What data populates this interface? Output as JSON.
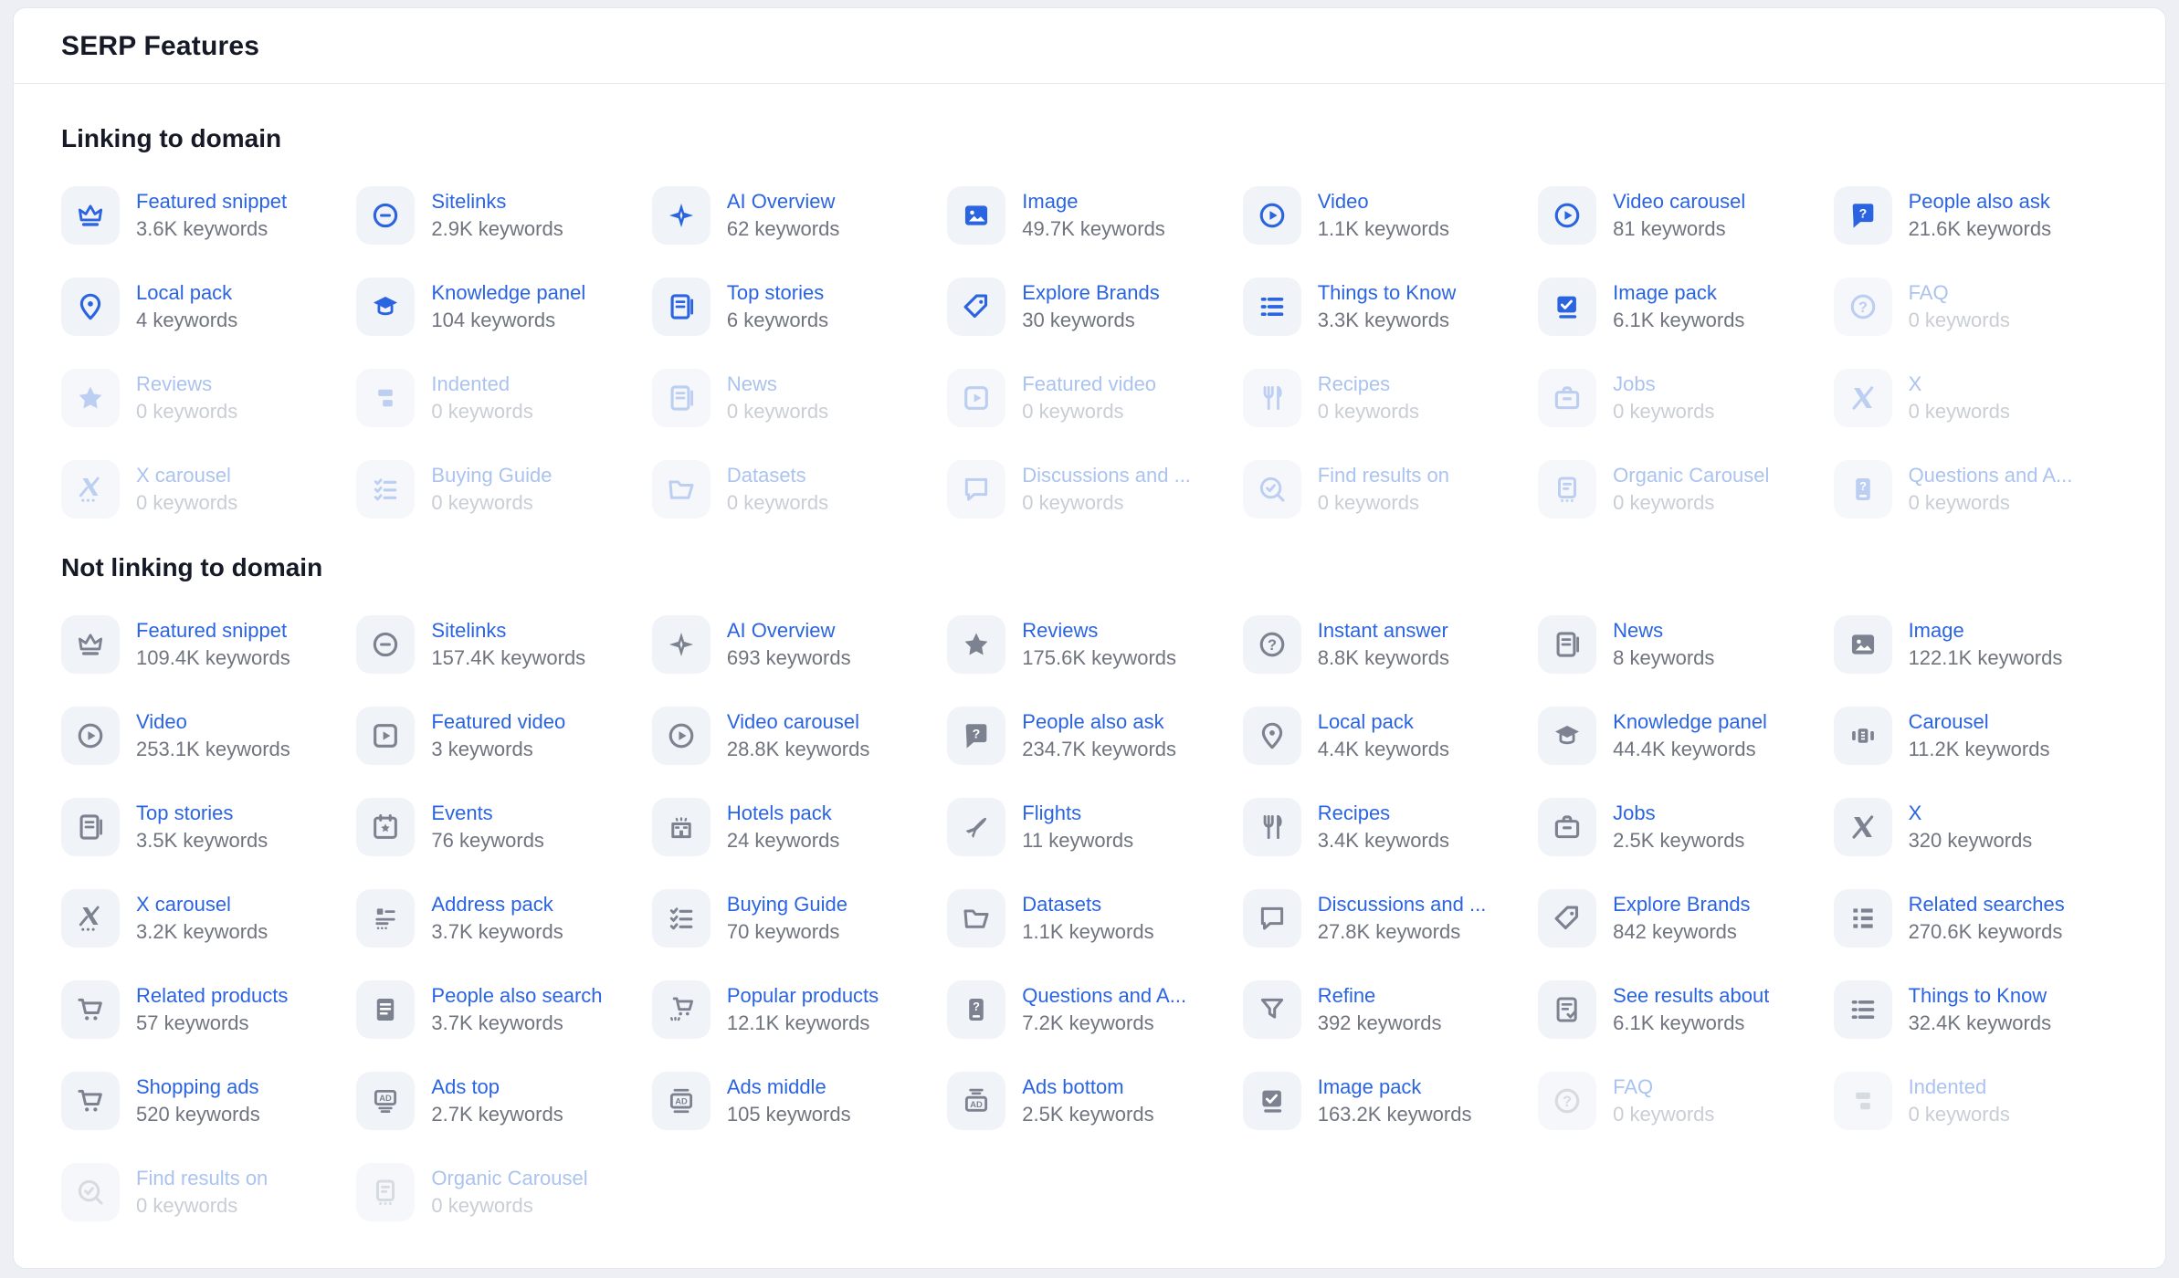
{
  "page_title": "SERP Features",
  "colors": {
    "accent_blue": "#2b64e0",
    "icon_gray": "#7c828f",
    "tile_background": "#f0f3f8",
    "count_gray": "#70747e",
    "disabled_blue": "#abc3ee",
    "card_background": "#ffffff",
    "page_background": "#edeff4"
  },
  "sections": [
    {
      "title": "Linking to domain",
      "icon_tone": "blue",
      "items": [
        {
          "label": "Featured snippet",
          "count": "3.6K keywords",
          "icon": "crown-icon",
          "disabled": false
        },
        {
          "label": "Sitelinks",
          "count": "2.9K keywords",
          "icon": "sitelinks-icon",
          "disabled": false
        },
        {
          "label": "AI Overview",
          "count": "62 keywords",
          "icon": "sparkle-icon",
          "disabled": false
        },
        {
          "label": "Image",
          "count": "49.7K keywords",
          "icon": "image-icon",
          "disabled": false
        },
        {
          "label": "Video",
          "count": "1.1K keywords",
          "icon": "play-circle-icon",
          "disabled": false
        },
        {
          "label": "Video carousel",
          "count": "81 keywords",
          "icon": "play-circle-icon",
          "disabled": false
        },
        {
          "label": "People also ask",
          "count": "21.6K keywords",
          "icon": "question-bubble-icon",
          "disabled": false
        },
        {
          "label": "Local pack",
          "count": "4 keywords",
          "icon": "map-pin-icon",
          "disabled": false
        },
        {
          "label": "Knowledge panel",
          "count": "104 keywords",
          "icon": "graduation-cap-icon",
          "disabled": false
        },
        {
          "label": "Top stories",
          "count": "6 keywords",
          "icon": "news-pages-icon",
          "disabled": false
        },
        {
          "label": "Explore Brands",
          "count": "30 keywords",
          "icon": "tag-icon",
          "disabled": false
        },
        {
          "label": "Things to Know",
          "count": "3.3K keywords",
          "icon": "list-icon",
          "disabled": false
        },
        {
          "label": "Image pack",
          "count": "6.1K keywords",
          "icon": "image-stack-icon",
          "disabled": false
        },
        {
          "label": "FAQ",
          "count": "0 keywords",
          "icon": "question-circle-icon",
          "disabled": true
        },
        {
          "label": "Reviews",
          "count": "0 keywords",
          "icon": "star-icon",
          "disabled": true
        },
        {
          "label": "Indented",
          "count": "0 keywords",
          "icon": "indent-icon",
          "disabled": true
        },
        {
          "label": "News",
          "count": "0 keywords",
          "icon": "news-pages-icon",
          "disabled": true
        },
        {
          "label": "Featured video",
          "count": "0 keywords",
          "icon": "play-square-icon",
          "disabled": true
        },
        {
          "label": "Recipes",
          "count": "0 keywords",
          "icon": "cutlery-icon",
          "disabled": true
        },
        {
          "label": "Jobs",
          "count": "0 keywords",
          "icon": "briefcase-icon",
          "disabled": true
        },
        {
          "label": "X",
          "count": "0 keywords",
          "icon": "x-logo-icon",
          "disabled": true
        },
        {
          "label": "X carousel",
          "count": "0 keywords",
          "icon": "x-carousel-icon",
          "disabled": true
        },
        {
          "label": "Buying Guide",
          "count": "0 keywords",
          "icon": "checklist-icon",
          "disabled": true
        },
        {
          "label": "Datasets",
          "count": "0 keywords",
          "icon": "folder-icon",
          "disabled": true
        },
        {
          "label": "Discussions and ...",
          "count": "0 keywords",
          "icon": "chat-bubble-icon",
          "disabled": true
        },
        {
          "label": "Find results on",
          "count": "0 keywords",
          "icon": "search-check-icon",
          "disabled": true
        },
        {
          "label": "Organic Carousel",
          "count": "0 keywords",
          "icon": "page-dots-icon",
          "disabled": true
        },
        {
          "label": "Questions and A...",
          "count": "0 keywords",
          "icon": "question-card-icon",
          "disabled": true
        }
      ]
    },
    {
      "title": "Not linking to domain",
      "icon_tone": "gray",
      "items": [
        {
          "label": "Featured snippet",
          "count": "109.4K keywords",
          "icon": "crown-icon",
          "disabled": false
        },
        {
          "label": "Sitelinks",
          "count": "157.4K keywords",
          "icon": "sitelinks-icon",
          "disabled": false
        },
        {
          "label": "AI Overview",
          "count": "693 keywords",
          "icon": "sparkle-icon",
          "disabled": false
        },
        {
          "label": "Reviews",
          "count": "175.6K keywords",
          "icon": "star-icon",
          "disabled": false
        },
        {
          "label": "Instant answer",
          "count": "8.8K keywords",
          "icon": "question-circle-icon",
          "disabled": false
        },
        {
          "label": "News",
          "count": "8 keywords",
          "icon": "news-pages-icon",
          "disabled": false
        },
        {
          "label": "Image",
          "count": "122.1K keywords",
          "icon": "image-icon",
          "disabled": false
        },
        {
          "label": "Video",
          "count": "253.1K keywords",
          "icon": "play-circle-icon",
          "disabled": false
        },
        {
          "label": "Featured video",
          "count": "3 keywords",
          "icon": "play-square-icon",
          "disabled": false
        },
        {
          "label": "Video carousel",
          "count": "28.8K keywords",
          "icon": "play-circle-icon",
          "disabled": false
        },
        {
          "label": "People also ask",
          "count": "234.7K keywords",
          "icon": "question-bubble-icon",
          "disabled": false
        },
        {
          "label": "Local pack",
          "count": "4.4K keywords",
          "icon": "map-pin-icon",
          "disabled": false
        },
        {
          "label": "Knowledge panel",
          "count": "44.4K keywords",
          "icon": "graduation-cap-icon",
          "disabled": false
        },
        {
          "label": "Carousel",
          "count": "11.2K keywords",
          "icon": "carousel-icon",
          "disabled": false
        },
        {
          "label": "Top stories",
          "count": "3.5K keywords",
          "icon": "news-pages-icon",
          "disabled": false
        },
        {
          "label": "Events",
          "count": "76 keywords",
          "icon": "calendar-icon",
          "disabled": false
        },
        {
          "label": "Hotels pack",
          "count": "24 keywords",
          "icon": "hotel-icon",
          "disabled": false
        },
        {
          "label": "Flights",
          "count": "11 keywords",
          "icon": "plane-icon",
          "disabled": false
        },
        {
          "label": "Recipes",
          "count": "3.4K keywords",
          "icon": "cutlery-icon",
          "disabled": false
        },
        {
          "label": "Jobs",
          "count": "2.5K keywords",
          "icon": "briefcase-icon",
          "disabled": false
        },
        {
          "label": "X",
          "count": "320 keywords",
          "icon": "x-logo-icon",
          "disabled": false
        },
        {
          "label": "X carousel",
          "count": "3.2K keywords",
          "icon": "x-carousel-icon",
          "disabled": false
        },
        {
          "label": "Address pack",
          "count": "3.7K keywords",
          "icon": "address-icon",
          "disabled": false
        },
        {
          "label": "Buying Guide",
          "count": "70 keywords",
          "icon": "checklist-icon",
          "disabled": false
        },
        {
          "label": "Datasets",
          "count": "1.1K keywords",
          "icon": "folder-icon",
          "disabled": false
        },
        {
          "label": "Discussions and ...",
          "count": "27.8K keywords",
          "icon": "chat-bubble-icon",
          "disabled": false
        },
        {
          "label": "Explore Brands",
          "count": "842 keywords",
          "icon": "tag-icon",
          "disabled": false
        },
        {
          "label": "Related searches",
          "count": "270.6K keywords",
          "icon": "grid-icon",
          "disabled": false
        },
        {
          "label": "Related products",
          "count": "57 keywords",
          "icon": "cart-icon",
          "disabled": false
        },
        {
          "label": "People also search",
          "count": "3.7K keywords",
          "icon": "document-icon",
          "disabled": false
        },
        {
          "label": "Popular products",
          "count": "12.1K keywords",
          "icon": "cart-stars-icon",
          "disabled": false
        },
        {
          "label": "Questions and A...",
          "count": "7.2K keywords",
          "icon": "question-card-icon",
          "disabled": false
        },
        {
          "label": "Refine",
          "count": "392 keywords",
          "icon": "funnel-icon",
          "disabled": false
        },
        {
          "label": "See results about",
          "count": "6.1K keywords",
          "icon": "document-check-icon",
          "disabled": false
        },
        {
          "label": "Things to Know",
          "count": "32.4K keywords",
          "icon": "list-icon",
          "disabled": false
        },
        {
          "label": "Shopping ads",
          "count": "520 keywords",
          "icon": "cart-icon",
          "disabled": false
        },
        {
          "label": "Ads top",
          "count": "2.7K keywords",
          "icon": "ad-top-icon",
          "disabled": false
        },
        {
          "label": "Ads middle",
          "count": "105 keywords",
          "icon": "ad-middle-icon",
          "disabled": false
        },
        {
          "label": "Ads bottom",
          "count": "2.5K keywords",
          "icon": "ad-bottom-icon",
          "disabled": false
        },
        {
          "label": "Image pack",
          "count": "163.2K keywords",
          "icon": "image-stack-icon",
          "disabled": false
        },
        {
          "label": "FAQ",
          "count": "0 keywords",
          "icon": "question-circle-icon",
          "disabled": true
        },
        {
          "label": "Indented",
          "count": "0 keywords",
          "icon": "indent-icon",
          "disabled": true
        },
        {
          "label": "Find results on",
          "count": "0 keywords",
          "icon": "search-check-icon",
          "disabled": true
        },
        {
          "label": "Organic Carousel",
          "count": "0 keywords",
          "icon": "page-dots-icon",
          "disabled": true
        }
      ]
    }
  ]
}
